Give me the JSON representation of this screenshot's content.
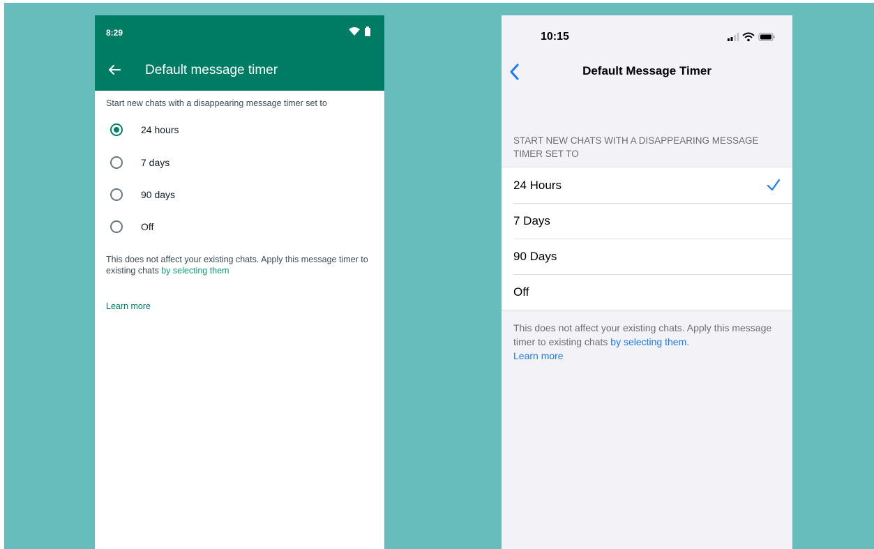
{
  "android": {
    "status_time": "8:29",
    "title": "Default message timer",
    "subtitle": "Start new chats with a disappearing message timer set to",
    "options": [
      {
        "label": "24 hours",
        "selected": true
      },
      {
        "label": "7 days",
        "selected": false
      },
      {
        "label": "90 days",
        "selected": false
      },
      {
        "label": "Off",
        "selected": false
      }
    ],
    "note_text": "This does not affect your existing chats. Apply this message timer to existing chats ",
    "note_link": "by selecting them",
    "learn_more": "Learn more",
    "colors": {
      "appbar": "#017c64",
      "accent": "#008069",
      "backdrop": "#66bdbc"
    },
    "icons": {
      "back": "arrow-left-icon",
      "wifi": "wifi-icon",
      "battery": "battery-icon"
    }
  },
  "ios": {
    "status_time": "10:15",
    "title": "Default Message Timer",
    "section_header": "START NEW CHATS WITH A DISAPPEARING MESSAGE TIMER SET TO",
    "options": [
      {
        "label": "24 Hours",
        "selected": true
      },
      {
        "label": "7 Days",
        "selected": false
      },
      {
        "label": "90 Days",
        "selected": false
      },
      {
        "label": "Off",
        "selected": false
      }
    ],
    "footer_text": "This does not affect your existing chats. Apply this message timer to existing chats ",
    "footer_link": "by selecting them",
    "footer_period": ".",
    "learn_more": "Learn more",
    "colors": {
      "tint": "#1a7af8",
      "background": "#f2f2f7"
    },
    "icons": {
      "back": "chevron-left-icon",
      "check": "checkmark-icon",
      "signal": "signal-icon",
      "wifi": "wifi-icon",
      "battery": "battery-icon"
    }
  }
}
